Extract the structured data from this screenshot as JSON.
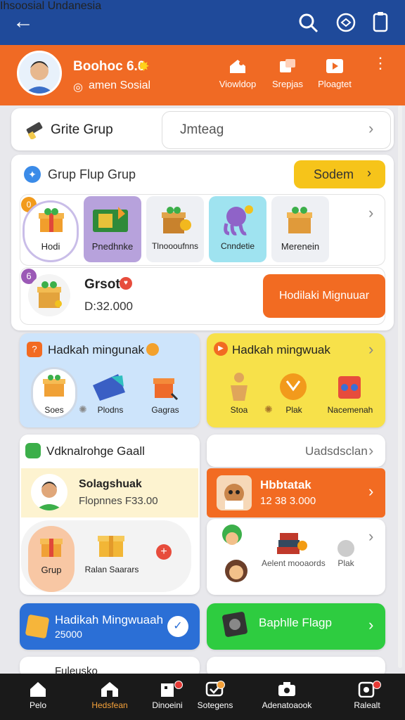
{
  "header": {
    "title": "Ihsoosial Undanesia"
  },
  "profile": {
    "name": "Boohoc 6.0",
    "subtitle": "amen Sosial",
    "tabs": [
      {
        "label": "Viowldop",
        "icon": "home-gift-icon"
      },
      {
        "label": "Srepjas",
        "icon": "photos-icon"
      },
      {
        "label": "Ploagtet",
        "icon": "video-icon"
      }
    ]
  },
  "create_group": {
    "label": "Grite Grup",
    "input_value": "Jmteag"
  },
  "group_section": {
    "title": "Grup Flup Grup",
    "button": "Sodem",
    "tiles": [
      "Hodi",
      "Pnedhnke",
      "Tlnoooufnns",
      "Cnndetie",
      "Merenein"
    ],
    "badge": "0"
  },
  "gift_row": {
    "badge": "6",
    "name": "Grsot",
    "amount": "D:32.000",
    "button": "Hodilaki Mignuuar"
  },
  "weekly": [
    {
      "title": "Hadkah mingunak",
      "items": [
        "Soes",
        "Plodns",
        "Gagras"
      ]
    },
    {
      "title": "Hadkah mingwuak",
      "items": [
        "Stoa",
        "Plak",
        "Nacemenah"
      ]
    }
  ],
  "vote": {
    "title": "Vdknalrohge Gaall",
    "right_label": "Uadsdsclan"
  },
  "leader": {
    "name": "Solagshuak",
    "value": "Flopnnes F33.00"
  },
  "hot": {
    "title": "Hbbtatak",
    "value": "12 38 3.000"
  },
  "gifts_left": {
    "items": [
      "Grup",
      "Ralan Saarars"
    ]
  },
  "gifts_right": {
    "items": [
      "Aelent mooaords",
      "Plak"
    ]
  },
  "promo_blue": {
    "title": "Hadikah Mingwuaah",
    "value": "25000"
  },
  "promo_green": {
    "title": "Baphlle Flagp"
  },
  "partial_row": {
    "label": "Fuleusko"
  },
  "nav": [
    "Pelo",
    "Hedsfean",
    "Dinoeini",
    "Sotegens",
    "Adenatoaook",
    "Ralealt"
  ],
  "colors": {
    "header": "#1f4a9a",
    "profile": "#f06a24",
    "accent_orange": "#f26b22",
    "green": "#2ecc40",
    "blue": "#2b6fd6",
    "yellow": "#f5dc45"
  }
}
